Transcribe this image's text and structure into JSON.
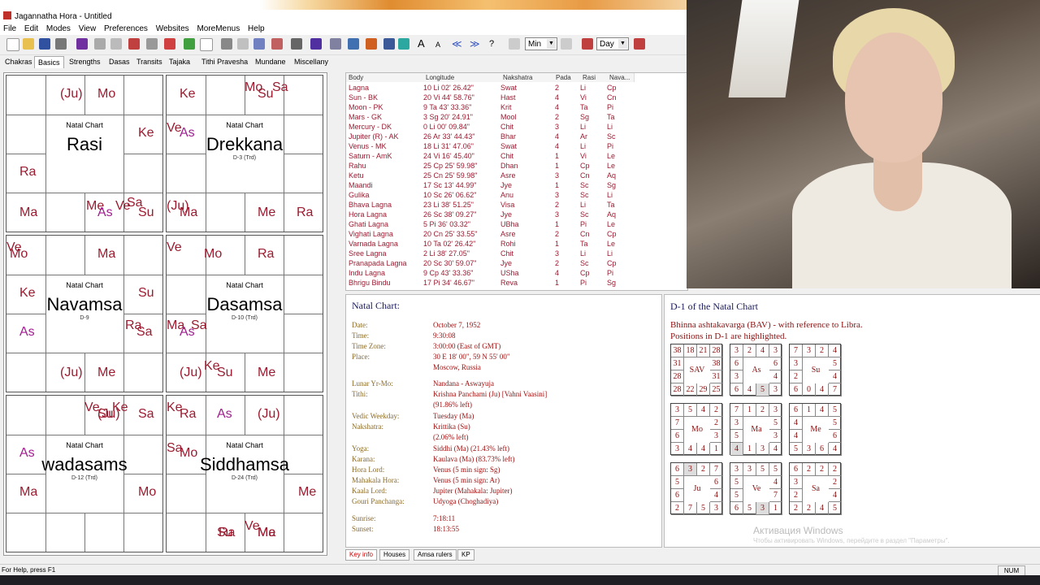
{
  "window": {
    "title": "Jagannatha Hora - Untitled"
  },
  "menu": [
    "File",
    "Edit",
    "Modes",
    "View",
    "Preferences",
    "Websites",
    "MoreMenus",
    "Help"
  ],
  "toolbar": {
    "dropdown1": "Min",
    "dropdown2": "Day"
  },
  "tabs": [
    "Chakras",
    "Basics",
    "Strengths",
    "Dasas",
    "Transits",
    "Tajaka",
    "Tithi Pravesha",
    "Mundane",
    "Miscellany"
  ],
  "charts": [
    {
      "title": "Natal Chart",
      "name": "Rasi",
      "sub": ""
    },
    {
      "title": "Natal Chart",
      "name": "Drekkana",
      "sub": "D-3 (Trd)"
    },
    {
      "title": "Natal Chart",
      "name": "Navamsa",
      "sub": "D-9"
    },
    {
      "title": "Natal Chart",
      "name": "Dasamsa",
      "sub": "D-10 (Trd)"
    },
    {
      "title": "Natal Chart",
      "name": "wadasams",
      "sub": "D-12 (Trd)"
    },
    {
      "title": "Natal Chart",
      "name": "Siddhamsa",
      "sub": "D-24 (Trd)"
    }
  ],
  "planets": {
    "c0": [
      "(Ju)",
      "Mo",
      "Ke",
      "Ra",
      "Ma",
      "Me",
      "As",
      "Ve",
      "Sa",
      "Su"
    ],
    "c1": [
      "Ke",
      "Mo",
      "Su",
      "Sa",
      "Ve",
      "As",
      "(Ju)",
      "Ma",
      "Me",
      "Ra"
    ],
    "c2": [
      "Ve",
      "Mo",
      "Ma",
      "Ke",
      "Su",
      "As",
      "Ra",
      "Sa",
      "(Ju)",
      "Me"
    ],
    "c3": [
      "Ve",
      "Mo",
      "Ra",
      "Ma",
      "As",
      "Sa",
      "(Ju)",
      "Ke",
      "Su",
      "Me"
    ],
    "c4": [
      "Ve",
      "Su",
      "Ke",
      "Sa",
      "(Ju)",
      "As",
      "Ma",
      "Mo"
    ],
    "c5": [
      "Ke",
      "Ra",
      "As",
      "(Ju)",
      "Sa",
      "Mo",
      "Me",
      "Ra",
      "Me",
      "Su",
      "Ve",
      "Ma"
    ]
  },
  "table": {
    "headers": [
      "Body",
      "Longitude",
      "Nakshatra",
      "Pada",
      "Rasi",
      "Nava..."
    ],
    "rows": [
      [
        "Lagna",
        "10 Li 02' 26.42\"",
        "Swat",
        "2",
        "Li",
        "Cp"
      ],
      [
        "Sun - BK",
        "20 Vi 44' 58.76\"",
        "Hast",
        "4",
        "Vi",
        "Cn"
      ],
      [
        "Moon - PK",
        "9 Ta 43' 33.36\"",
        "Krit",
        "4",
        "Ta",
        "Pi"
      ],
      [
        "Mars - GK",
        "3 Sg 20' 24.91\"",
        "Mool",
        "2",
        "Sg",
        "Ta"
      ],
      [
        "Mercury - DK",
        "0 Li 00' 09.84\"",
        "Chit",
        "3",
        "Li",
        "Li"
      ],
      [
        "Jupiter (R) - AK",
        "26 Ar 33' 44.43\"",
        "Bhar",
        "4",
        "Ar",
        "Sc"
      ],
      [
        "Venus - MK",
        "18 Li 31' 47.06\"",
        "Swat",
        "4",
        "Li",
        "Pi"
      ],
      [
        "Saturn - AmK",
        "24 Vi 16' 45.40\"",
        "Chit",
        "1",
        "Vi",
        "Le"
      ],
      [
        "Rahu",
        "25 Cp 25' 59.98\"",
        "Dhan",
        "1",
        "Cp",
        "Le"
      ],
      [
        "Ketu",
        "25 Cn 25' 59.98\"",
        "Asre",
        "3",
        "Cn",
        "Aq"
      ],
      [
        "Maandi",
        "17 Sc 13' 44.99\"",
        "Jye",
        "1",
        "Sc",
        "Sg"
      ],
      [
        "Gulika",
        "10 Sc 26' 06.62\"",
        "Anu",
        "3",
        "Sc",
        "Li"
      ],
      [
        "Bhava Lagna",
        "23 Li 38' 51.25\"",
        "Visa",
        "2",
        "Li",
        "Ta"
      ],
      [
        "Hora Lagna",
        "26 Sc 38' 09.27\"",
        "Jye",
        "3",
        "Sc",
        "Aq"
      ],
      [
        "Ghati Lagna",
        "5 Pi 36' 03.32\"",
        "UBha",
        "1",
        "Pi",
        "Le"
      ],
      [
        "Vighati Lagna",
        "20 Cn 25' 33.55\"",
        "Asre",
        "2",
        "Cn",
        "Cp"
      ],
      [
        "Varnada Lagna",
        "10 Ta 02' 26.42\"",
        "Rohi",
        "1",
        "Ta",
        "Le"
      ],
      [
        "Sree Lagna",
        "2 Li 38' 27.05\"",
        "Chit",
        "3",
        "Li",
        "Li"
      ],
      [
        "Pranapada Lagna",
        "20 Sc 30' 59.07\"",
        "Jye",
        "2",
        "Sc",
        "Cp"
      ],
      [
        "Indu Lagna",
        "9 Cp 43' 33.36\"",
        "USha",
        "4",
        "Cp",
        "Pi"
      ],
      [
        "Bhrigu Bindu",
        "17 Pi 34' 46.67\"",
        "Reva",
        "1",
        "Pi",
        "Sg"
      ]
    ]
  },
  "info": {
    "header": "Natal Chart:",
    "items": [
      [
        "Date:",
        "October 7, 1952"
      ],
      [
        "Time:",
        "9:30:08"
      ],
      [
        "Time Zone:",
        "3:00:00 (East of GMT)"
      ],
      [
        "Place:",
        "30 E 18' 00\", 59 N 55' 00\""
      ],
      [
        "",
        "Moscow, Russia"
      ],
      [
        "Lunar Yr-Mo:",
        "Nandana - Aswayuja"
      ],
      [
        "Tithi:",
        "Krishna Panchami (Ju) [Vahni Vaasini]"
      ],
      [
        "",
        "(91.86% left)"
      ],
      [
        "Vedic Weekday:",
        "Tuesday (Ma)"
      ],
      [
        "Nakshatra:",
        "Krittika (Su)"
      ],
      [
        "",
        "(2.06% left)"
      ],
      [
        "Yoga:",
        "Siddhi (Ma) (21.43% left)"
      ],
      [
        "Karana:",
        "Kaulava (Ma) (83.73% left)"
      ],
      [
        "Hora Lord:",
        "Venus (5 min sign: Sg)"
      ],
      [
        "Mahakala Hora:",
        "Venus (5 min sign: Ar)"
      ],
      [
        "Kaala Lord:",
        "Jupiter (Mahakala: Jupiter)"
      ],
      [
        "Gouri Panchanga:",
        "Udyoga (Choghadiya)"
      ],
      [
        "Sunrise:",
        "7:18:11"
      ],
      [
        "Sunset:",
        "18:13:55"
      ]
    ]
  },
  "bav": {
    "title": "D-1 of the Natal Chart",
    "desc1": "Bhinna ashtakavarga (BAV) - with reference to Libra.",
    "desc2": "Positions in D-1 are highlighted.",
    "grids": [
      {
        "name": "SAV",
        "cells": [
          "38",
          "18",
          "21",
          "28",
          "31",
          "",
          "",
          "38",
          "28",
          "",
          "",
          "31",
          "28",
          "22",
          "29",
          "25"
        ]
      },
      {
        "name": "As",
        "cells": [
          "3",
          "2",
          "4",
          "3",
          "6",
          "",
          "",
          "6",
          "3",
          "",
          "",
          "4",
          "6",
          "4",
          "5",
          "3"
        ]
      },
      {
        "name": "Su",
        "cells": [
          "7",
          "3",
          "2",
          "4",
          "3",
          "",
          "",
          "5",
          "2",
          "",
          "",
          "4",
          "6",
          "0",
          "4",
          "7"
        ]
      },
      {
        "name": "Mo",
        "cells": [
          "3",
          "5",
          "4",
          "2",
          "7",
          "",
          "",
          "2",
          "6",
          "",
          "",
          "3",
          "3",
          "4",
          "4",
          "1"
        ]
      },
      {
        "name": "Ma",
        "cells": [
          "7",
          "1",
          "2",
          "3",
          "3",
          "",
          "",
          "5",
          "5",
          "",
          "",
          "3",
          "4",
          "1",
          "3",
          "4"
        ]
      },
      {
        "name": "Me",
        "cells": [
          "6",
          "1",
          "4",
          "5",
          "4",
          "",
          "",
          "5",
          "4",
          "",
          "",
          "6",
          "5",
          "3",
          "6",
          "4"
        ]
      },
      {
        "name": "Ju",
        "cells": [
          "6",
          "3",
          "2",
          "7",
          "5",
          "",
          "",
          "6",
          "6",
          "",
          "",
          "4",
          "2",
          "7",
          "5",
          "3"
        ]
      },
      {
        "name": "Ve",
        "cells": [
          "3",
          "3",
          "5",
          "5",
          "5",
          "",
          "",
          "4",
          "5",
          "",
          "",
          "7",
          "6",
          "5",
          "3",
          "1"
        ]
      },
      {
        "name": "Sa",
        "cells": [
          "6",
          "2",
          "2",
          "2",
          "3",
          "",
          "",
          "2",
          "2",
          "",
          "",
          "4",
          "2",
          "2",
          "4",
          "5"
        ]
      }
    ]
  },
  "bottom_tabs": [
    "Key info",
    "Houses",
    "Amsa rulers",
    "KP"
  ],
  "status": {
    "help": "For Help, press F1",
    "num": "NUM"
  },
  "watermark": {
    "line1": "Активация Windows",
    "line2": "Чтобы активировать Windows, перейдите в раздел \"Параметры\"."
  },
  "colors": {
    "planet": "#9b1b30",
    "accent": "#1a1a5a"
  }
}
